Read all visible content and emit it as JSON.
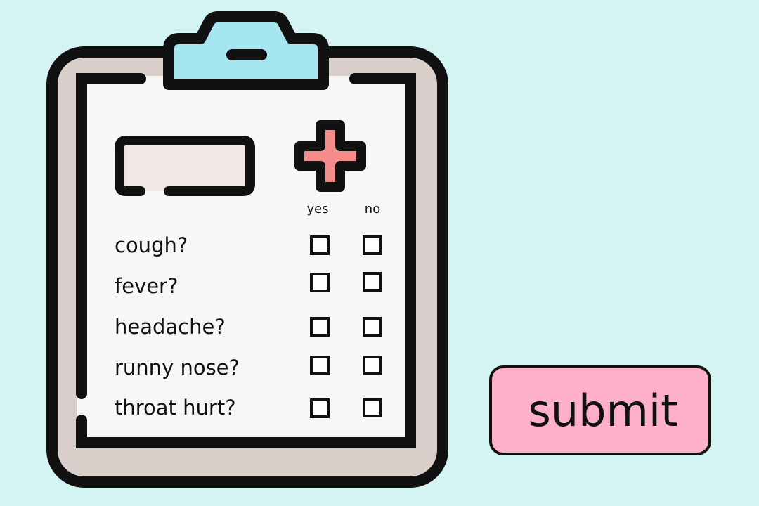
{
  "form": {
    "columns": {
      "yes": "yes",
      "no": "no"
    },
    "questions": [
      {
        "label": "cough?"
      },
      {
        "label": "fever?"
      },
      {
        "label": "headache?"
      },
      {
        "label": "runny nose?"
      },
      {
        "label": "throat hurt?"
      }
    ]
  },
  "submit": {
    "label": "submit"
  },
  "icons": {
    "clipboard": "clipboard-icon",
    "medical_cross": "medical-cross-icon",
    "clip": "clip-icon",
    "name_field": "name-field-icon"
  },
  "colors": {
    "background": "#d4f4f3",
    "clip": "#a6e6f0",
    "cross": "#f58c8c",
    "submit": "#ffb0c9",
    "paper": "#f7f7f5",
    "board": "#d9cec9"
  }
}
